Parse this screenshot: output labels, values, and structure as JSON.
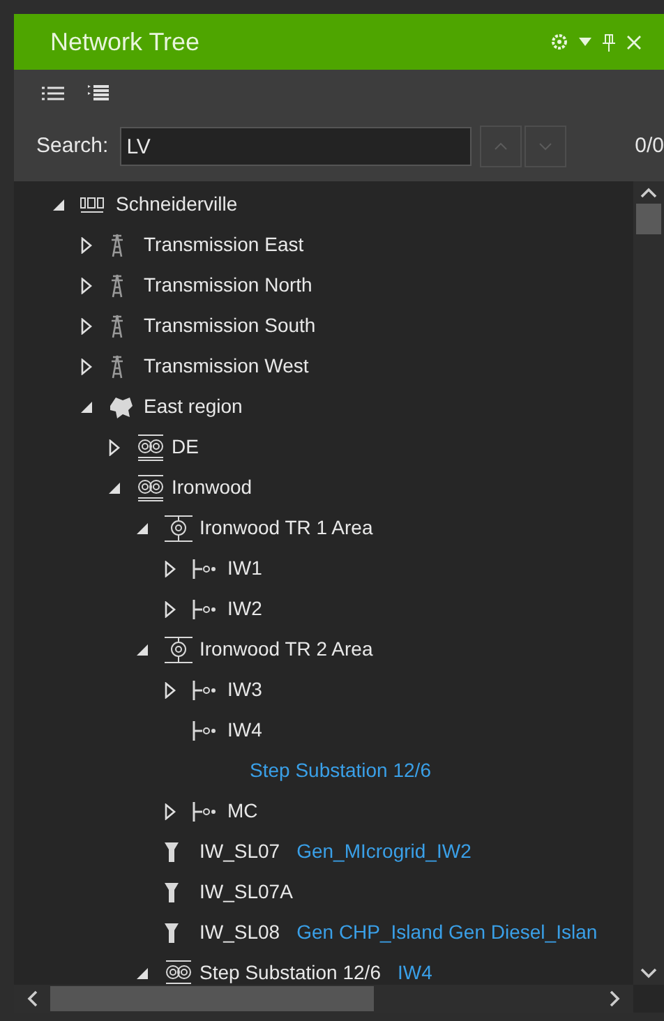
{
  "panel": {
    "title": "Network Tree"
  },
  "search": {
    "label": "Search:",
    "value": "LV",
    "count": "0/0"
  },
  "tree": [
    {
      "label": "Schneiderville",
      "kind": "dms",
      "expanded": true,
      "children": [
        {
          "label": "Transmission East",
          "kind": "tower",
          "expanded": false
        },
        {
          "label": "Transmission North",
          "kind": "tower",
          "expanded": false
        },
        {
          "label": "Transmission South",
          "kind": "tower",
          "expanded": false
        },
        {
          "label": "Transmission West",
          "kind": "tower",
          "expanded": false
        },
        {
          "label": "East region",
          "kind": "region",
          "expanded": true,
          "children": [
            {
              "label": "DE",
              "kind": "substation",
              "expanded": false
            },
            {
              "label": "Ironwood",
              "kind": "substation",
              "expanded": true,
              "children": [
                {
                  "label": "Ironwood TR 1 Area",
                  "kind": "transformer",
                  "expanded": true,
                  "children": [
                    {
                      "label": "IW1",
                      "kind": "feeder",
                      "expanded": false
                    },
                    {
                      "label": "IW2",
                      "kind": "feeder",
                      "expanded": false
                    }
                  ]
                },
                {
                  "label": "Ironwood TR 2 Area",
                  "kind": "transformer",
                  "expanded": true,
                  "children": [
                    {
                      "label": "IW3",
                      "kind": "feeder",
                      "expanded": false
                    },
                    {
                      "label": "IW4",
                      "kind": "feeder",
                      "note": "Step Substation 12/6"
                    },
                    {
                      "label": "MC",
                      "kind": "feeder",
                      "expanded": false
                    }
                  ]
                },
                {
                  "label": "IW_SL07",
                  "kind": "switch",
                  "link": "Gen_MIcrogrid_IW2"
                },
                {
                  "label": "IW_SL07A",
                  "kind": "switch"
                },
                {
                  "label": "IW_SL08",
                  "kind": "switch",
                  "link": "Gen CHP_Island Gen Diesel_Islan"
                },
                {
                  "label": "Step Substation 12/6",
                  "kind": "substation",
                  "expanded": true,
                  "link": "IW4"
                }
              ]
            }
          ]
        }
      ]
    }
  ]
}
